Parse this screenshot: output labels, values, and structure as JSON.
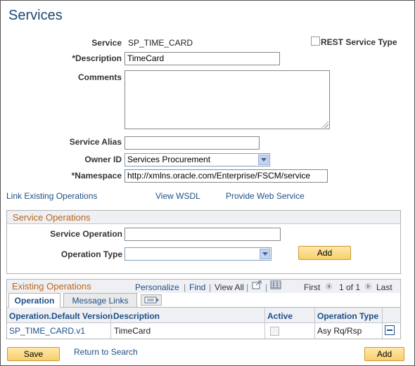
{
  "page": {
    "title": "Services"
  },
  "form": {
    "service_label": "Service",
    "service_value": "SP_TIME_CARD",
    "rest_label": "REST Service Type",
    "description_label": "*Description",
    "description_value": "TimeCard",
    "comments_label": "Comments",
    "comments_value": "",
    "alias_label": "Service Alias",
    "alias_value": "",
    "owner_label": "Owner ID",
    "owner_value": "Services Procurement",
    "namespace_label": "*Namespace",
    "namespace_value": "http://xmlns.oracle.com/Enterprise/FSCM/service"
  },
  "links": {
    "link_existing": "Link Existing Operations",
    "view_wsdl": "View WSDL",
    "provide_ws": "Provide Web Service"
  },
  "service_operations": {
    "title": "Service Operations",
    "operation_label": "Service Operation",
    "operation_value": "",
    "type_label": "Operation Type",
    "type_value": "",
    "add_label": "Add"
  },
  "existing_operations": {
    "title": "Existing Operations",
    "personalize": "Personalize",
    "find": "Find",
    "view_all": "View All",
    "first": "First",
    "page_info": "1 of 1",
    "last": "Last",
    "tabs": [
      "Operation",
      "Message Links"
    ],
    "columns": [
      "Operation.Default Version",
      "Description",
      "Active",
      "Operation Type"
    ],
    "rows": [
      {
        "operation": "SP_TIME_CARD.v1",
        "description": "TimeCard",
        "active": false,
        "type": "Asy Rq/Rsp"
      }
    ]
  },
  "footer": {
    "save_label": "Save",
    "return_label": "Return to Search",
    "add_label": "Add"
  },
  "colors": {
    "link": "#1e4f87",
    "group_title": "#b8651a",
    "button": "#f7cf6e",
    "title": "#1c4a72"
  }
}
